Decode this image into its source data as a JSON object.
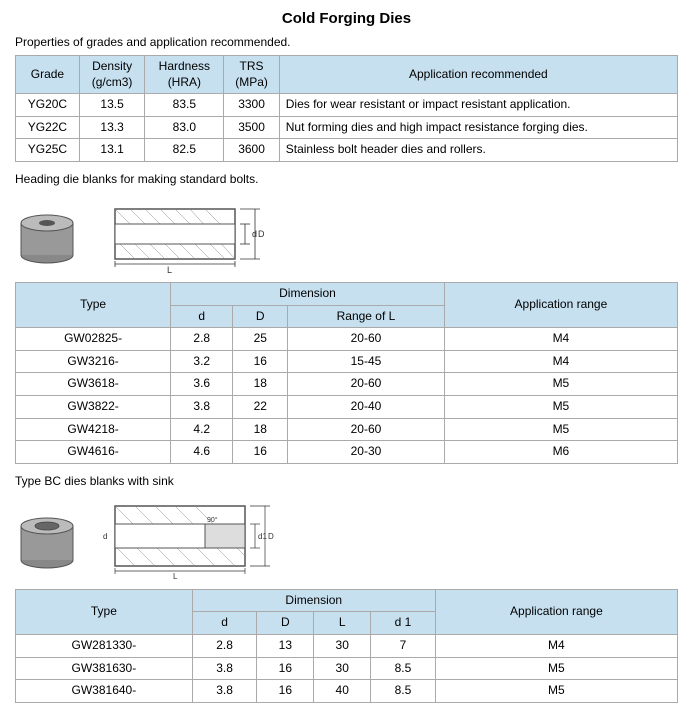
{
  "page": {
    "title": "Cold Forging Dies",
    "intro": "Properties of grades and application recommended.",
    "grades_table": {
      "headers": [
        "Grade",
        "Density (g/cm3)",
        "Hardness (HRA)",
        "TRS (MPa)",
        "Application recommended"
      ],
      "rows": [
        [
          "YG20C",
          "13.5",
          "83.5",
          "3300",
          "Dies for wear resistant or impact resistant application."
        ],
        [
          "YG22C",
          "13.3",
          "83.0",
          "3500",
          "Nut forming dies and high impact resistance forging dies."
        ],
        [
          "YG25C",
          "13.1",
          "82.5",
          "3600",
          "Stainless bolt header dies and rollers."
        ]
      ]
    },
    "heading_die_label": "Heading die blanks for making standard bolts.",
    "heading_die_table": {
      "dim_header": "Dimension",
      "headers": [
        "Type",
        "d",
        "D",
        "Range of L",
        "Application range"
      ],
      "rows": [
        [
          "GW02825-",
          "2.8",
          "25",
          "20-60",
          "M4"
        ],
        [
          "GW3216-",
          "3.2",
          "16",
          "15-45",
          "M4"
        ],
        [
          "GW3618-",
          "3.6",
          "18",
          "20-60",
          "M5"
        ],
        [
          "GW3822-",
          "3.8",
          "22",
          "20-40",
          "M5"
        ],
        [
          "GW4218-",
          "4.2",
          "18",
          "20-60",
          "M5"
        ],
        [
          "GW4616-",
          "4.6",
          "16",
          "20-30",
          "M6"
        ]
      ]
    },
    "type_bc_label": "Type BC dies blanks with sink",
    "type_bc_table": {
      "dim_header": "Dimension",
      "headers": [
        "Type",
        "d",
        "D",
        "L",
        "d 1",
        "Application range"
      ],
      "rows": [
        [
          "GW281330-",
          "2.8",
          "13",
          "30",
          "7",
          "M4"
        ],
        [
          "GW381630-",
          "3.8",
          "16",
          "30",
          "8.5",
          "M5"
        ],
        [
          "GW381640-",
          "3.8",
          "16",
          "40",
          "8.5",
          "M5"
        ]
      ]
    }
  }
}
